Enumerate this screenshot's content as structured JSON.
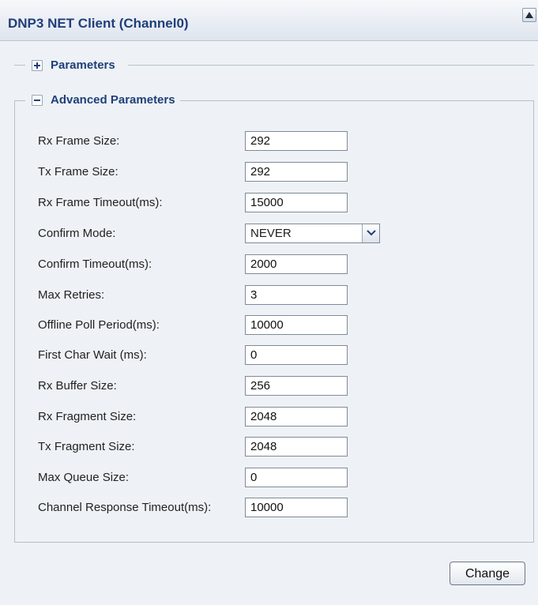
{
  "header": {
    "title": "DNP3 NET Client (Channel0)"
  },
  "sections": {
    "parameters_label": "Parameters",
    "advanced_label": "Advanced Parameters"
  },
  "fields": [
    {
      "label": "Rx Frame Size:",
      "value": "292"
    },
    {
      "label": "Tx Frame Size:",
      "value": "292"
    },
    {
      "label": "Rx Frame Timeout(ms):",
      "value": "15000"
    },
    {
      "label": "Confirm Mode:",
      "value": "NEVER"
    },
    {
      "label": "Confirm Timeout(ms):",
      "value": "2000"
    },
    {
      "label": "Max Retries:",
      "value": "3"
    },
    {
      "label": "Offline Poll Period(ms):",
      "value": "10000"
    },
    {
      "label": "First Char Wait (ms):",
      "value": "0"
    },
    {
      "label": "Rx Buffer Size:",
      "value": "256"
    },
    {
      "label": "Rx Fragment Size:",
      "value": "2048"
    },
    {
      "label": "Tx Fragment Size:",
      "value": "2048"
    },
    {
      "label": "Max Queue Size:",
      "value": "0"
    },
    {
      "label": "Channel Response Timeout(ms):",
      "value": "10000"
    }
  ],
  "buttons": {
    "change_label": "Change"
  }
}
